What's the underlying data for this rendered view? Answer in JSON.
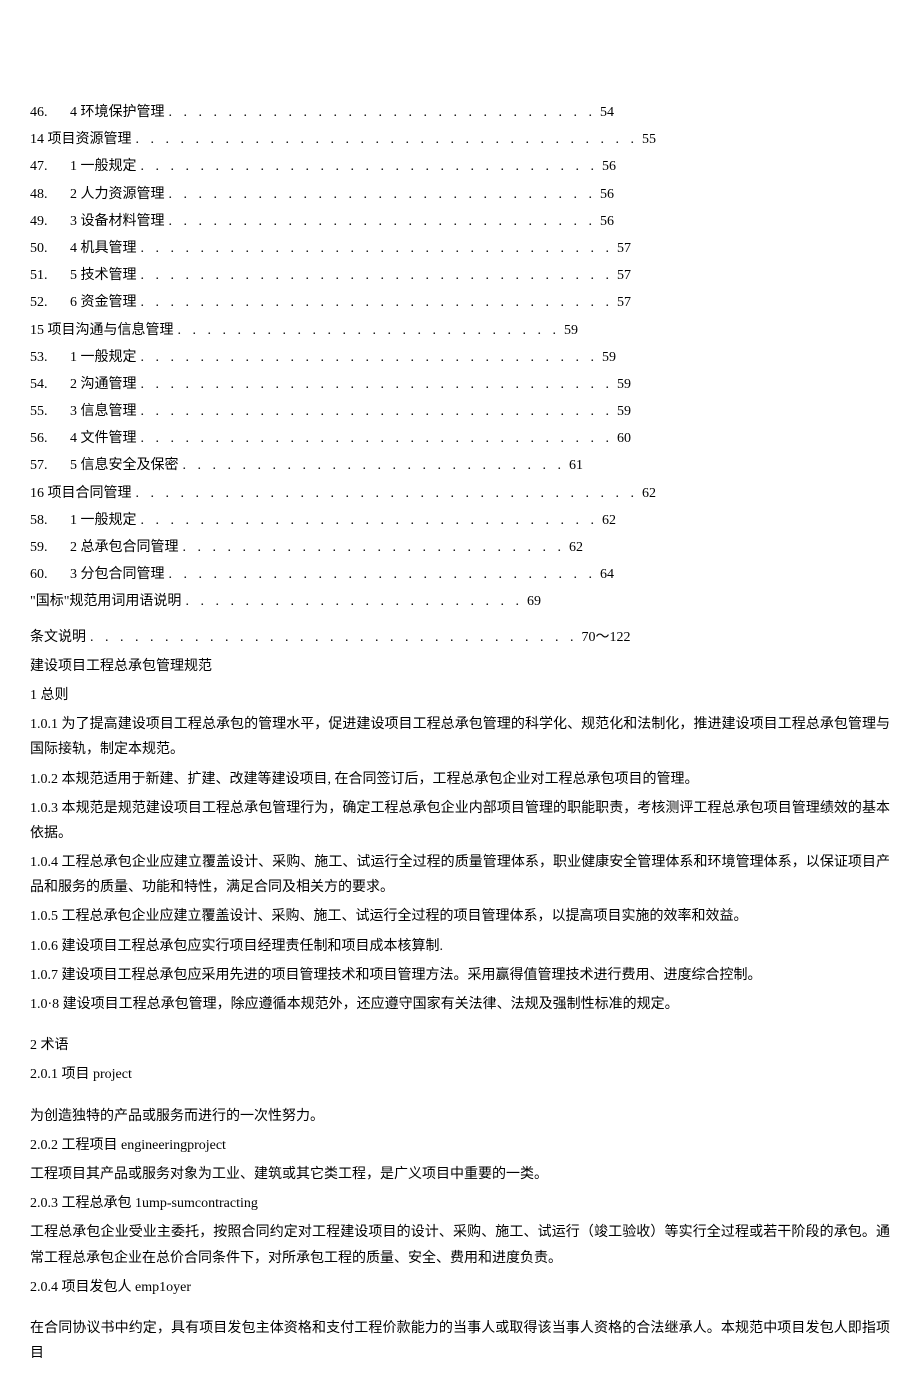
{
  "toc": [
    {
      "num": "46.",
      "title": "4 环境保护管理",
      "dots": ". . . . . . . . . . . . . . . . . . . . . . . . . . . . .",
      "page": "54"
    },
    {
      "num": "",
      "title": "14 项目资源管理",
      "dots": ". . . . . . . . . . . . . . . . . . . . . . . . . . . . . . . . . .",
      "page": "55"
    },
    {
      "num": "47.",
      "title": "1 一般规定",
      "dots": ". . . . . . . . . . . . . . . . . . . . . . . . . . . . . . .",
      "page": "56"
    },
    {
      "num": "48.",
      "title": "2 人力资源管理",
      "dots": ". . . . . . . . . . . . . . . . . . . . . . . . . . . . .",
      "page": "56"
    },
    {
      "num": "49.",
      "title": "3 设备材料管理",
      "dots": ". . . . . . . . . . . . . . . . . . . . . . . . . . . . .",
      "page": "56"
    },
    {
      "num": "50.",
      "title": "4 机具管理",
      "dots": ". . . . . . . . . . . . . . . . . . . . . . . . . . . . . . . .",
      "page": "57"
    },
    {
      "num": "51.",
      "title": "5 技术管理",
      "dots": ". . . . . . . . . . . . . . . . . . . . . . . . . . . . . . . .",
      "page": "57"
    },
    {
      "num": "52.",
      "title": "6 资金管理",
      "dots": ". . . . . . . . . . . . . . . . . . . . . . . . . . . . . . . .",
      "page": "57"
    },
    {
      "num": "",
      "title": "15 项目沟通与信息管理",
      "dots": ". . . . . . . . . . . . . . . . . . . . . . . . . .",
      "page": "59"
    },
    {
      "num": "53.",
      "title": "1 一般规定",
      "dots": ". . . . . . . . . . . . . . . . . . . . . . . . . . . . . . .",
      "page": "59"
    },
    {
      "num": "54.",
      "title": "2 沟通管理",
      "dots": ". . . . . . . . . . . . . . . . . . . . . . . . . . . . . . . .",
      "page": "59"
    },
    {
      "num": "55.",
      "title": "3 信息管理",
      "dots": ". . . . . . . . . . . . . . . . . . . . . . . . . . . . . . . .",
      "page": "59"
    },
    {
      "num": "56.",
      "title": "4 文件管理",
      "dots": ". . . . . . . . . . . . . . . . . . . . . . . . . . . . . . . .",
      "page": "60"
    },
    {
      "num": "57.",
      "title": "5 信息安全及保密",
      "dots": ". . . . . . . . . . . . . . . . . . . . . . . . . .",
      "page": "61"
    },
    {
      "num": "",
      "title": "16 项目合同管理",
      "dots": ". . . . . . . . . . . . . . . . . . . . . . . . . . . . . . . . . .",
      "page": "62"
    },
    {
      "num": "58.",
      "title": "1 一般规定",
      "dots": ". . . . . . . . . . . . . . . . . . . . . . . . . . . . . . .",
      "page": "62"
    },
    {
      "num": "59.",
      "title": "2 总承包合同管理",
      "dots": ". . . . . . . . . . . . . . . . . . . . . . . . . .",
      "page": "62"
    },
    {
      "num": "60.",
      "title": "3 分包合同管理",
      "dots": ". . . . . . . . . . . . . . . . . . . . . . . . . . . . .",
      "page": "64"
    },
    {
      "num": "",
      "title": "\"国标\"规范用词用语说明",
      "dots": ". . . . . . . . . . . . . . . . . . . . . . .",
      "page": "69"
    }
  ],
  "toc_footer": {
    "title": "条文说明",
    "dots": ". . . . . . . . . . . . . . . . . . . . . . . . . . . . . . . . .",
    "page": "70～122"
  },
  "body": {
    "title": "建设项目工程总承包管理规范",
    "s1_head": "1 总则",
    "p101": "1.0.1 为了提高建设项目工程总承包的管理水平，促进建设项目工程总承包管理的科学化、规范化和法制化，推进建设项目工程总承包管理与国际接轨，制定本规范。",
    "p102": "1.0.2 本规范适用于新建、扩建、改建等建设项目, 在合同签订后，工程总承包企业对工程总承包项目的管理。",
    "p103": "1.0.3 本规范是规范建设项目工程总承包管理行为，确定工程总承包企业内部项目管理的职能职责，考核测评工程总承包项目管理绩效的基本依据。",
    "p104": "1.0.4 工程总承包企业应建立覆盖设计、采购、施工、试运行全过程的质量管理体系，职业健康安全管理体系和环境管理体系，以保证项目产品和服务的质量、功能和特性，满足合同及相关方的要求。",
    "p105": "1.0.5 工程总承包企业应建立覆盖设计、采购、施工、试运行全过程的项目管理体系，以提高项目实施的效率和效益。",
    "p106": "1.0.6 建设项目工程总承包应实行项目经理责任制和项目成本核算制.",
    "p107": "1.0.7 建设项目工程总承包应采用先进的项目管理技术和项目管理方法。采用赢得值管理技术进行费用、进度综合控制。",
    "p108": "1.0·8 建设项目工程总承包管理，除应遵循本规范外，还应遵守国家有关法律、法规及强制性标准的规定。",
    "s2_head": "2 术语",
    "p201": "2.0.1 项目 project",
    "p201b": "为创造独特的产品或服务而进行的一次性努力。",
    "p202": "2.0.2 工程项目 engineeringproject",
    "p202b": "工程项目其产品或服务对象为工业、建筑或其它类工程，是广义项目中重要的一类。",
    "p203": "2.0.3 工程总承包 1ump-sumcontracting",
    "p203b": "工程总承包企业受业主委托，按照合同约定对工程建设项目的设计、采购、施工、试运行（竣工验收）等实行全过程或若干阶段的承包。通常工程总承包企业在总价合同条件下，对所承包工程的质量、安全、费用和进度负责。",
    "p204": "2.0.4 项目发包人 emp1oyer",
    "p204b": "在合同协议书中约定，具有项目发包主体资格和支付工程价款能力的当事人或取得该当事人资格的合法继承人。本规范中项目发包人即指项目"
  }
}
